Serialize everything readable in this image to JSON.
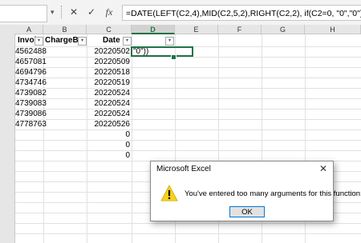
{
  "formula_bar": {
    "name_box": "",
    "cancel_icon": "✕",
    "enter_icon": "✓",
    "fx_label": "fx",
    "formula": "=DATE(LEFT(C2,4),MID(C2,5,2),RIGHT(C2,2), if(C2=0, \"0\",\"0\"))"
  },
  "columns": [
    "A",
    "B",
    "C",
    "D",
    "E",
    "F",
    "G",
    "H"
  ],
  "header_row": {
    "invoice": "Invoice #",
    "chargeback": "ChargeBack",
    "date": "Date",
    "filter_glyph": "▾"
  },
  "rows": [
    {
      "invoice": "4562488",
      "date": "20220502",
      "d": "\"0\"))"
    },
    {
      "invoice": "4657081",
      "date": "20220509",
      "d": ""
    },
    {
      "invoice": "4694796",
      "date": "20220518",
      "d": ""
    },
    {
      "invoice": "4734746",
      "date": "20220519",
      "d": ""
    },
    {
      "invoice": "4739082",
      "date": "20220524",
      "d": ""
    },
    {
      "invoice": "4739083",
      "date": "20220524",
      "d": ""
    },
    {
      "invoice": "4739086",
      "date": "20220524",
      "d": ""
    },
    {
      "invoice": "4778763",
      "date": "20220526",
      "d": ""
    },
    {
      "invoice": "",
      "date": "0",
      "d": ""
    },
    {
      "invoice": "",
      "date": "0",
      "d": ""
    },
    {
      "invoice": "",
      "date": "0",
      "d": ""
    }
  ],
  "dialog": {
    "title": "Microsoft Excel",
    "close_icon": "✕",
    "message": "You've entered too many arguments for this function.",
    "ok_label": "OK",
    "warning_color": "#f8d21c"
  },
  "colors": {
    "excel_green": "#217346",
    "header_gray": "#e6e6e6",
    "gridline": "#e1e1e1"
  }
}
